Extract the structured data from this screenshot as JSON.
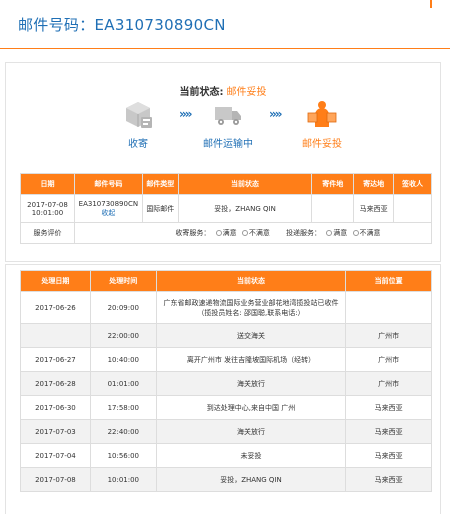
{
  "header": {
    "label": "邮件号码：",
    "tracking_no": "EA310730890CN"
  },
  "status": {
    "label": "当前状态:",
    "value": "邮件妥投",
    "steps": [
      {
        "name": "收寄",
        "icon": "package-icon"
      },
      {
        "name": "邮件运输中",
        "icon": "truck-icon"
      },
      {
        "name": "邮件妥投",
        "icon": "delivery-person-icon"
      }
    ],
    "arrow": "»»"
  },
  "summary": {
    "headers": [
      "日期",
      "邮件号码",
      "邮件类型",
      "当前状态",
      "寄件地",
      "寄达地",
      "签收人"
    ],
    "row": {
      "date": "2017-07-08 10:01:00",
      "tracking_no": "EA310730890CN",
      "collapse_link": "收起",
      "type": "国际邮件",
      "status": "妥投，ZHANG QIN",
      "origin": "",
      "destination": "马来西亚",
      "signer": ""
    },
    "evaluation": {
      "label": "服务评价",
      "collect_label": "收寄服务：",
      "deliver_label": "投递服务：",
      "satisfied": "满意",
      "unsatisfied": "不满意"
    }
  },
  "history": {
    "headers": [
      "处理日期",
      "处理时间",
      "当前状态",
      "当前位置"
    ],
    "rows": [
      {
        "date": "2017-06-26",
        "time": "20:09:00",
        "status": "广东省邮政速递物流国际业务营业部花地湾揽投站已收件（揽投员姓名: 邵国聪,联系电话:）",
        "location": ""
      },
      {
        "date": "",
        "time": "22:00:00",
        "status": "送交海关",
        "location": "广州市"
      },
      {
        "date": "2017-06-27",
        "time": "10:40:00",
        "status": "离开广州市 发往吉隆坡国际机场（经转）",
        "location": "广州市"
      },
      {
        "date": "2017-06-28",
        "time": "01:01:00",
        "status": "海关放行",
        "location": "广州市"
      },
      {
        "date": "2017-06-30",
        "time": "17:58:00",
        "status": "到达处理中心,来自中国 广州",
        "location": "马来西亚"
      },
      {
        "date": "2017-07-03",
        "time": "22:40:00",
        "status": "海关放行",
        "location": "马来西亚"
      },
      {
        "date": "2017-07-04",
        "time": "10:56:00",
        "status": "未妥投",
        "location": "马来西亚"
      },
      {
        "date": "2017-07-08",
        "time": "10:01:00",
        "status": "妥投，ZHANG QIN",
        "location": "马来西亚"
      }
    ]
  },
  "colors": {
    "accent": "#ff7e18",
    "brand_blue": "#1f6fb5",
    "stripe": "#f2f2f2"
  }
}
